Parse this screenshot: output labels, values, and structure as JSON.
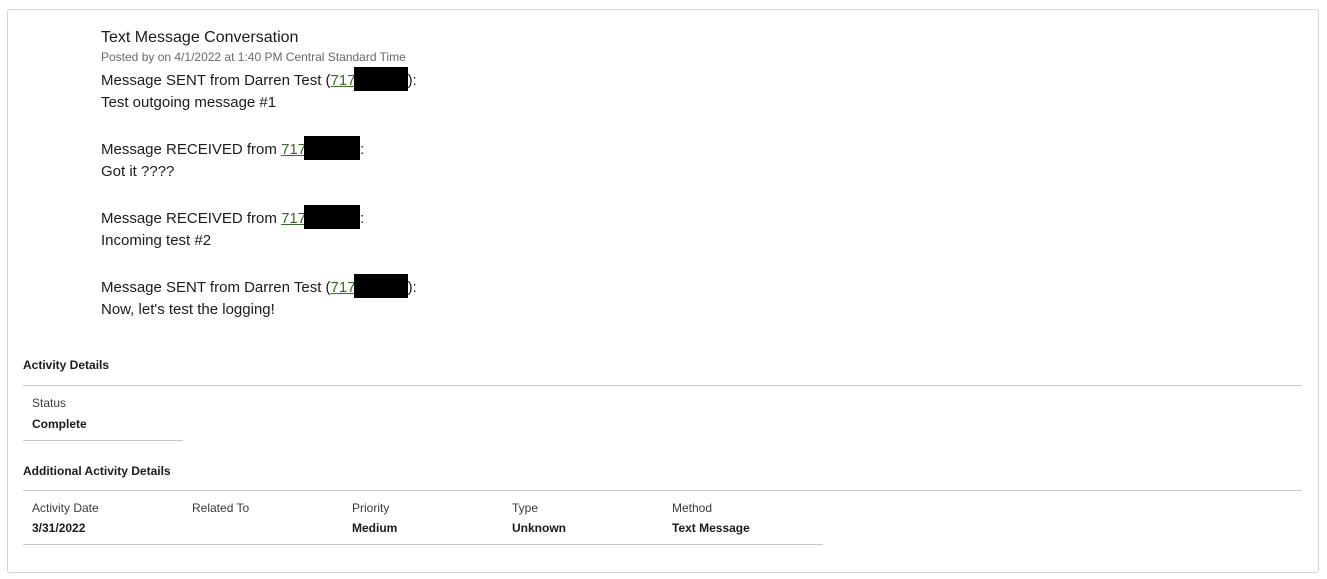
{
  "post": {
    "title": "Text Message Conversation",
    "meta": "Posted by on 4/1/2022 at 1:40 PM Central Standard Time",
    "messages": [
      {
        "prefix": "Message SENT from Darren Test (",
        "phone": "717",
        "suffix": "):",
        "body": "Test outgoing message #1"
      },
      {
        "prefix": "Message RECEIVED from ",
        "phone": "717",
        "suffix": ":",
        "body": "Got it ????"
      },
      {
        "prefix": "Message RECEIVED from ",
        "phone": "717",
        "suffix": ":",
        "body": "Incoming test #2"
      },
      {
        "prefix": "Message SENT from Darren Test (",
        "phone": "717",
        "suffix": "):",
        "body": "Now, let's test the logging!"
      }
    ]
  },
  "activity_details": {
    "title": "Activity Details",
    "status_label": "Status",
    "status_value": "Complete"
  },
  "additional_details": {
    "title": "Additional Activity Details",
    "activity_date_label": "Activity Date",
    "activity_date_value": "3/31/2022",
    "related_to_label": "Related To",
    "related_to_value": "",
    "priority_label": "Priority",
    "priority_value": "Medium",
    "type_label": "Type",
    "type_value": "Unknown",
    "method_label": "Method",
    "method_value": "Text Message"
  },
  "colors": {
    "link": "#3d6a2a",
    "redaction": "#000000",
    "border": "#d4d4d4"
  }
}
